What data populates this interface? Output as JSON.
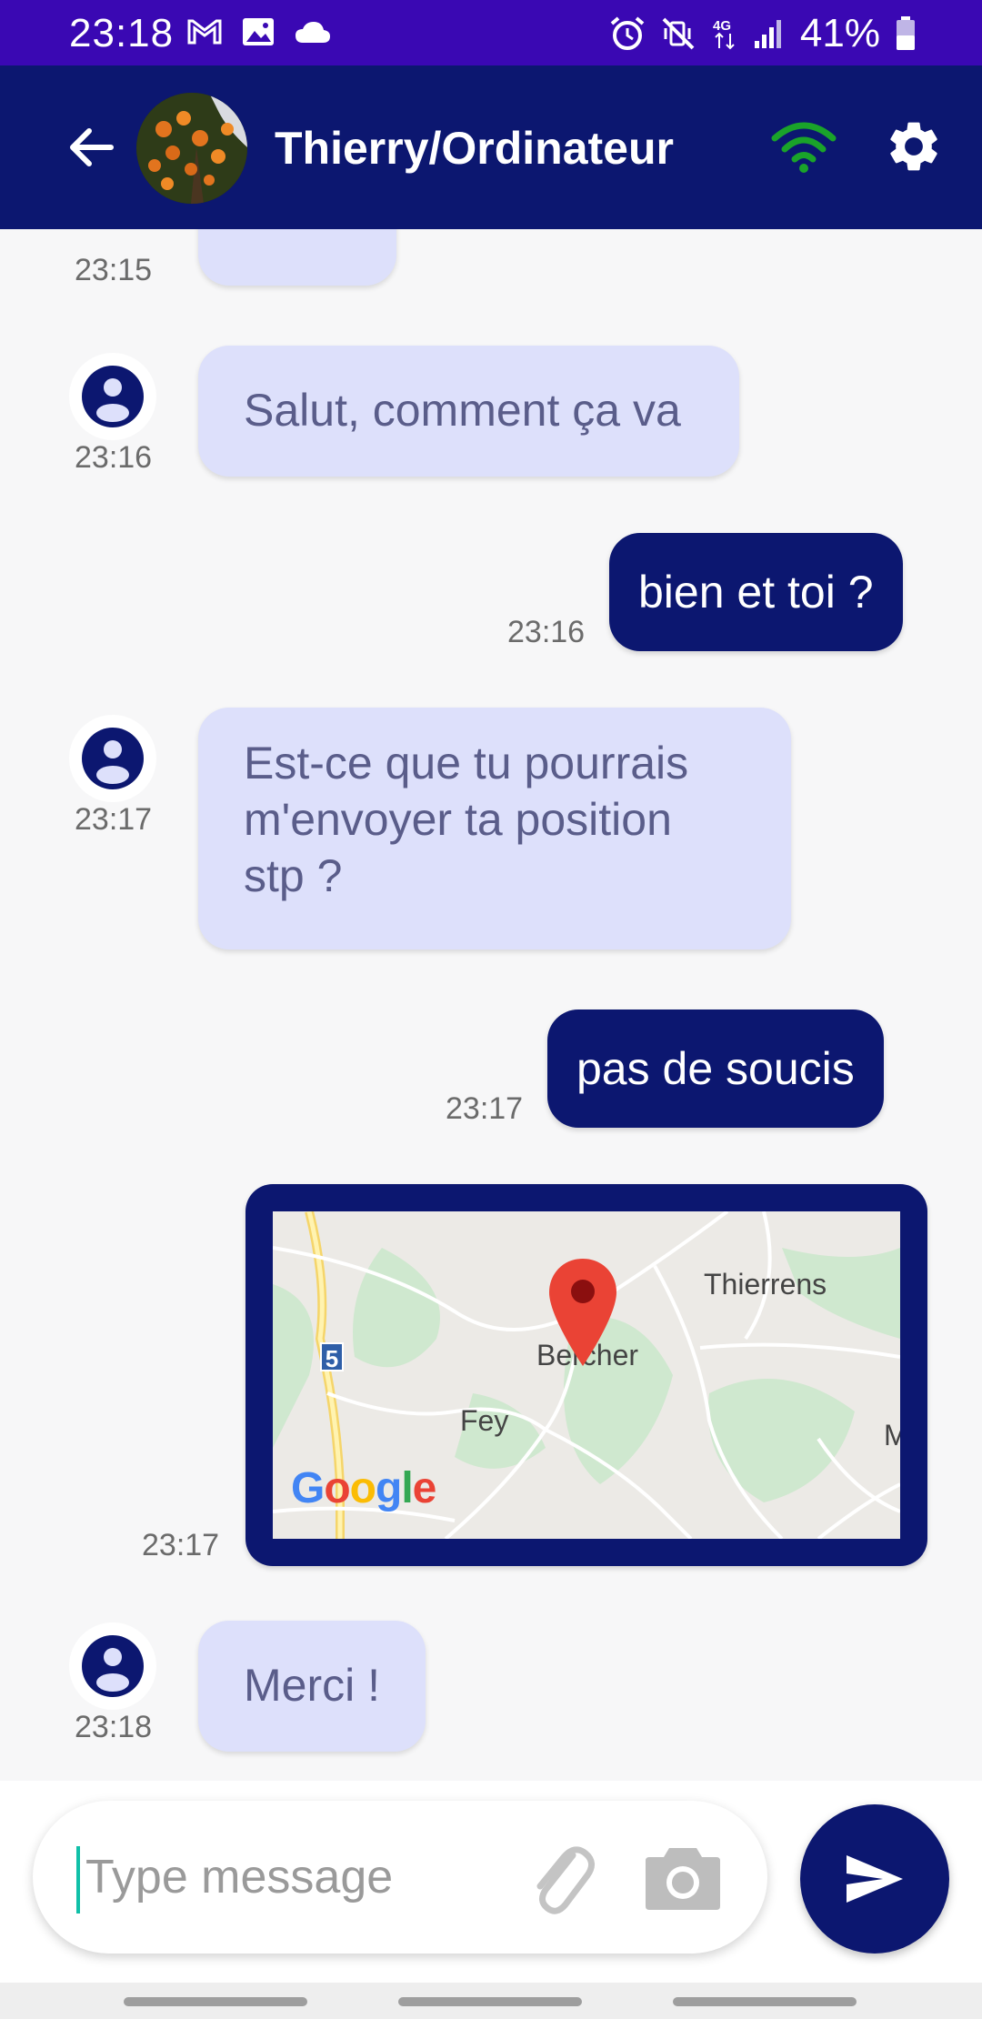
{
  "status_bar": {
    "time": "23:18",
    "battery": "41%",
    "network": "4G",
    "left_icons": [
      "gmail-icon",
      "gallery-icon",
      "cloud-icon"
    ],
    "right_icons": [
      "alarm-icon",
      "mute-icon",
      "4g-icon",
      "signal-icon",
      "battery-icon"
    ]
  },
  "app_bar": {
    "contact_name": "Thierry/Ordinateur",
    "connection_status_color": "#1aa32a"
  },
  "colors": {
    "status_bar": "#3a08b3",
    "primary": "#0c1770",
    "incoming_bubble": "#dde0fb",
    "incoming_text": "#5a5d8a"
  },
  "messages": [
    {
      "direction": "in",
      "time": "23:15",
      "text": ""
    },
    {
      "direction": "in",
      "time": "23:16",
      "text": "Salut, comment ça va"
    },
    {
      "direction": "out",
      "time": "23:16",
      "text": "bien et toi ?"
    },
    {
      "direction": "in",
      "time": "23:17",
      "lines": [
        "Est-ce que tu pourrais",
        "m'envoyer ta position",
        "stp ?"
      ]
    },
    {
      "direction": "out",
      "time": "23:17",
      "text": "pas de soucis"
    },
    {
      "direction": "out",
      "time": "23:17",
      "type": "map",
      "map_labels": [
        "Thierrens",
        "Bercher",
        "Fey",
        "5",
        "M"
      ],
      "map_brand": "Google"
    },
    {
      "direction": "in",
      "time": "23:18",
      "text": "Merci !"
    }
  ],
  "input_bar": {
    "placeholder": "Type message"
  }
}
